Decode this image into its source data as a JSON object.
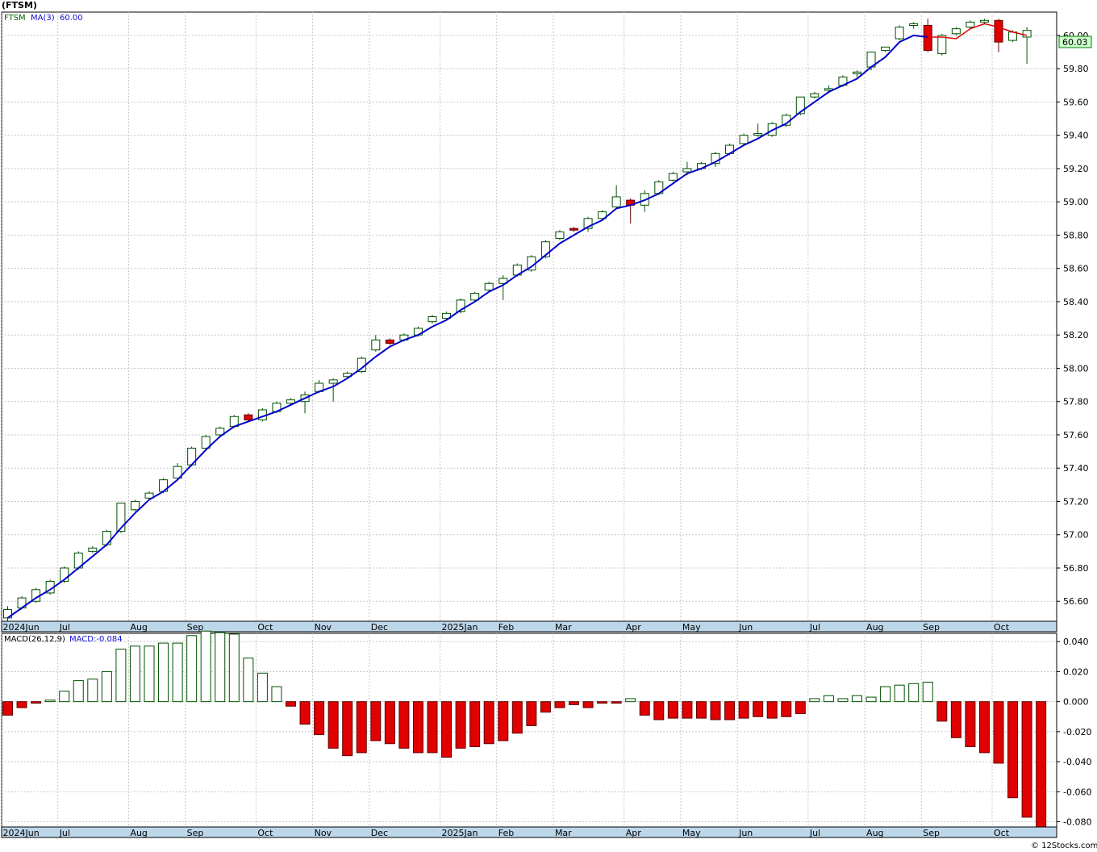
{
  "header": {
    "title": "(FTSM)"
  },
  "legend": {
    "symbol": "FTSM",
    "ma_label": "MA(3)",
    "ma_value": "60.00",
    "macd_label": "MACD(26,12,9)",
    "macd_value": "MACD:-0.084"
  },
  "last_price_label": "60.03",
  "footer": "© 12Stocks.com",
  "colors": {
    "up": "#00a000",
    "down": "#e00000",
    "ma": "#0000cc",
    "ma_recent": "#e00000",
    "grid": "#c8c8c8",
    "axis_bar": "#bcd6ea"
  },
  "chart_data": [
    {
      "type": "candlestick",
      "title": "(FTSM)",
      "ylim": [
        56.48,
        60.14
      ],
      "y_ticks": [
        56.6,
        56.8,
        57.0,
        57.2,
        57.4,
        57.6,
        57.8,
        58.0,
        58.2,
        58.4,
        58.6,
        58.8,
        59.0,
        59.2,
        59.4,
        59.6,
        59.8,
        60.0
      ],
      "y_tick_labels": [
        "56.60",
        "56.80",
        "57.00",
        "57.20",
        "57.40",
        "57.60",
        "57.80",
        "58.00",
        "58.20",
        "58.40",
        "58.60",
        "58.80",
        "59.00",
        "59.20",
        "59.40",
        "59.60",
        "59.80",
        "60.00"
      ],
      "x_labels": [
        {
          "i": 0,
          "label": "2024Jun"
        },
        {
          "i": 4,
          "label": "Jul"
        },
        {
          "i": 9,
          "label": "Aug"
        },
        {
          "i": 13,
          "label": "Sep"
        },
        {
          "i": 18,
          "label": "Oct"
        },
        {
          "i": 22,
          "label": "Nov"
        },
        {
          "i": 26,
          "label": "Dec"
        },
        {
          "i": 31,
          "label": "2025Jan"
        },
        {
          "i": 35,
          "label": "Feb"
        },
        {
          "i": 39,
          "label": "Mar"
        },
        {
          "i": 44,
          "label": "Apr"
        },
        {
          "i": 48,
          "label": "May"
        },
        {
          "i": 52,
          "label": "Jun"
        },
        {
          "i": 57,
          "label": "Jul"
        },
        {
          "i": 61,
          "label": "Aug"
        },
        {
          "i": 65,
          "label": "Sep"
        },
        {
          "i": 70,
          "label": "Oct"
        }
      ],
      "ohlc": [
        [
          56.5,
          56.57,
          56.48,
          56.55
        ],
        [
          56.56,
          56.63,
          56.55,
          56.62
        ],
        [
          56.6,
          56.68,
          56.59,
          56.67
        ],
        [
          56.65,
          56.73,
          56.64,
          56.72
        ],
        [
          56.72,
          56.81,
          56.71,
          56.8
        ],
        [
          56.8,
          56.9,
          56.79,
          56.89
        ],
        [
          56.9,
          56.93,
          56.89,
          56.92
        ],
        [
          56.94,
          57.03,
          56.93,
          57.02
        ],
        [
          57.02,
          57.19,
          57.01,
          57.19
        ],
        [
          57.15,
          57.21,
          57.14,
          57.2
        ],
        [
          57.22,
          57.26,
          57.21,
          57.25
        ],
        [
          57.26,
          57.34,
          57.25,
          57.33
        ],
        [
          57.34,
          57.43,
          57.33,
          57.41
        ],
        [
          57.42,
          57.53,
          57.41,
          57.52
        ],
        [
          57.52,
          57.6,
          57.51,
          57.59
        ],
        [
          57.6,
          57.65,
          57.59,
          57.64
        ],
        [
          57.65,
          57.72,
          57.64,
          57.71
        ],
        [
          57.72,
          57.73,
          57.68,
          57.69
        ],
        [
          57.69,
          57.76,
          57.68,
          57.75
        ],
        [
          57.74,
          57.8,
          57.73,
          57.79
        ],
        [
          57.79,
          57.82,
          57.78,
          57.81
        ],
        [
          57.8,
          57.86,
          57.73,
          57.84
        ],
        [
          57.86,
          57.93,
          57.85,
          57.91
        ],
        [
          57.91,
          57.94,
          57.8,
          57.93
        ],
        [
          57.95,
          57.98,
          57.94,
          57.97
        ],
        [
          57.98,
          58.07,
          57.97,
          58.06
        ],
        [
          58.11,
          58.2,
          58.1,
          58.17
        ],
        [
          58.17,
          58.18,
          58.14,
          58.15
        ],
        [
          58.17,
          58.21,
          58.16,
          58.2
        ],
        [
          58.2,
          58.25,
          58.19,
          58.24
        ],
        [
          58.28,
          58.32,
          58.27,
          58.31
        ],
        [
          58.3,
          58.34,
          58.29,
          58.33
        ],
        [
          58.34,
          58.42,
          58.33,
          58.41
        ],
        [
          58.41,
          58.46,
          58.4,
          58.45
        ],
        [
          58.47,
          58.52,
          58.46,
          58.51
        ],
        [
          58.51,
          58.56,
          58.41,
          58.54
        ],
        [
          58.56,
          58.63,
          58.55,
          58.62
        ],
        [
          58.59,
          58.68,
          58.58,
          58.67
        ],
        [
          58.67,
          58.77,
          58.66,
          58.76
        ],
        [
          58.78,
          58.83,
          58.77,
          58.82
        ],
        [
          58.84,
          58.85,
          58.82,
          58.83
        ],
        [
          58.84,
          58.91,
          58.82,
          58.9
        ],
        [
          58.9,
          58.95,
          58.89,
          58.94
        ],
        [
          58.97,
          59.1,
          58.96,
          59.03
        ],
        [
          59.01,
          59.02,
          58.87,
          58.98
        ],
        [
          58.98,
          59.07,
          58.94,
          59.05
        ],
        [
          59.05,
          59.13,
          59.04,
          59.12
        ],
        [
          59.13,
          59.18,
          59.12,
          59.17
        ],
        [
          59.18,
          59.24,
          59.16,
          59.2
        ],
        [
          59.2,
          59.24,
          59.19,
          59.23
        ],
        [
          59.23,
          59.3,
          59.21,
          59.29
        ],
        [
          59.29,
          59.35,
          59.28,
          59.34
        ],
        [
          59.35,
          59.41,
          59.34,
          59.4
        ],
        [
          59.4,
          59.47,
          59.39,
          59.41
        ],
        [
          59.4,
          59.48,
          59.39,
          59.47
        ],
        [
          59.46,
          59.53,
          59.45,
          59.52
        ],
        [
          59.53,
          59.63,
          59.52,
          59.63
        ],
        [
          59.63,
          59.66,
          59.62,
          59.65
        ],
        [
          59.67,
          59.7,
          59.66,
          59.68
        ],
        [
          59.7,
          59.76,
          59.69,
          59.75
        ],
        [
          59.77,
          59.79,
          59.75,
          59.78
        ],
        [
          59.81,
          59.9,
          59.79,
          59.9
        ],
        [
          59.91,
          59.93,
          59.9,
          59.93
        ],
        [
          59.98,
          60.06,
          59.97,
          60.05
        ],
        [
          60.06,
          60.08,
          60.04,
          60.07
        ],
        [
          60.06,
          60.1,
          59.9,
          59.91
        ],
        [
          59.89,
          60.01,
          59.88,
          60.0
        ],
        [
          60.01,
          60.05,
          60.0,
          60.04
        ],
        [
          60.05,
          60.09,
          60.04,
          60.08
        ],
        [
          60.08,
          60.1,
          60.07,
          60.09
        ],
        [
          60.09,
          60.1,
          59.9,
          59.96
        ],
        [
          59.97,
          60.03,
          59.96,
          60.02
        ],
        [
          59.99,
          60.05,
          59.83,
          60.03
        ]
      ],
      "ma3": [
        56.5,
        56.56,
        56.62,
        56.67,
        56.73,
        56.8,
        56.87,
        56.94,
        57.04,
        57.13,
        57.21,
        57.26,
        57.33,
        57.42,
        57.51,
        57.59,
        57.65,
        57.68,
        57.71,
        57.74,
        57.78,
        57.82,
        57.86,
        57.89,
        57.94,
        58.0,
        58.07,
        58.13,
        58.17,
        58.2,
        58.25,
        58.29,
        58.35,
        58.4,
        58.46,
        58.5,
        58.56,
        58.61,
        58.68,
        58.75,
        58.8,
        58.85,
        58.89,
        58.96,
        58.98,
        59.01,
        59.05,
        59.11,
        59.17,
        59.2,
        59.24,
        59.29,
        59.34,
        59.38,
        59.43,
        59.47,
        59.54,
        59.6,
        59.66,
        59.7,
        59.74,
        59.81,
        59.87,
        59.96,
        60.0,
        59.99,
        59.99,
        59.98,
        60.04,
        60.07,
        60.05,
        60.02,
        60.0
      ],
      "ma3_recent_from": 65
    },
    {
      "type": "bar",
      "title": "MACD(26,12,9)",
      "ylim": [
        -0.0835,
        0.0455
      ],
      "y_ticks": [
        0.04,
        0.02,
        0.0,
        -0.02,
        -0.04,
        -0.06,
        -0.08
      ],
      "y_tick_labels": [
        "0.040",
        "0.020",
        "0.000",
        "-0.020",
        "-0.040",
        "-0.060",
        "-0.080"
      ],
      "values": [
        -0.009,
        -0.004,
        -0.001,
        0.001,
        0.007,
        0.014,
        0.015,
        0.02,
        0.035,
        0.037,
        0.037,
        0.039,
        0.039,
        0.044,
        0.047,
        0.046,
        0.045,
        0.029,
        0.019,
        0.01,
        -0.003,
        -0.015,
        -0.022,
        -0.031,
        -0.036,
        -0.034,
        -0.026,
        -0.028,
        -0.031,
        -0.034,
        -0.034,
        -0.037,
        -0.031,
        -0.03,
        -0.028,
        -0.026,
        -0.021,
        -0.016,
        -0.007,
        -0.004,
        -0.002,
        -0.004,
        -0.001,
        -0.001,
        0.002,
        -0.009,
        -0.012,
        -0.011,
        -0.011,
        -0.011,
        -0.012,
        -0.012,
        -0.011,
        -0.01,
        -0.011,
        -0.01,
        -0.008,
        0.002,
        0.004,
        0.002,
        0.004,
        0.003,
        0.01,
        0.011,
        0.012,
        0.013,
        -0.013,
        -0.024,
        -0.03,
        -0.034,
        -0.041,
        -0.064,
        -0.077,
        -0.084
      ]
    }
  ]
}
